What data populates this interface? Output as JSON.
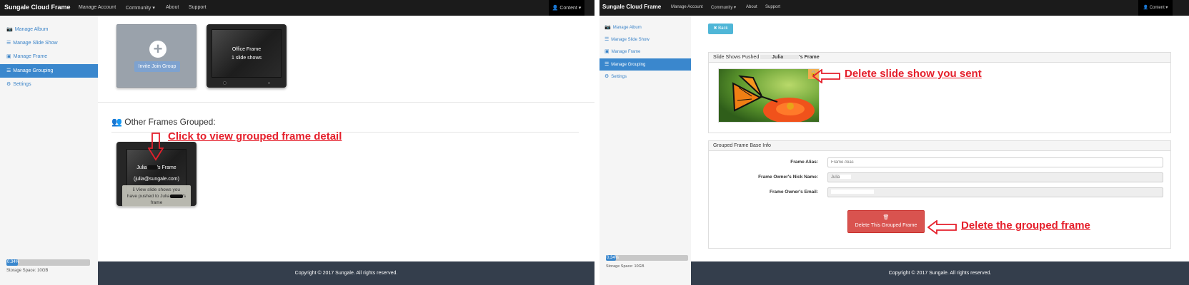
{
  "left": {
    "navbar": {
      "brand": "Sungale Cloud Frame",
      "items": [
        "Manage Account",
        "Community ▾",
        "About",
        "Support"
      ],
      "user_menu": "👤 Content ▾"
    },
    "sidebar": {
      "items": [
        {
          "icon": "camera-icon",
          "glyph": "📷",
          "label": "Manage Album"
        },
        {
          "icon": "list-icon",
          "glyph": "☰",
          "label": "Manage Slide Show"
        },
        {
          "icon": "picture-icon",
          "glyph": "▣",
          "label": "Manage Frame"
        },
        {
          "icon": "users-icon",
          "glyph": "☰",
          "label": "Manage Grouping"
        },
        {
          "icon": "gear-icon",
          "glyph": "⚙",
          "label": "Settings"
        }
      ],
      "active_index": 3,
      "storage_progress": {
        "label": "0.34%",
        "percent": 0.34
      },
      "storage_text": "Storage Space: 10GB"
    },
    "join_card": {
      "button_label": "Invite Join Group"
    },
    "office_frame": {
      "title": "Office Frame",
      "subtitle": "1 slide shows"
    },
    "other_frames_title": "Other Frames Grouped:",
    "grouped_frame": {
      "name_prefix": "Julia",
      "name_suffix": "'s Frame",
      "email": "(julia@sungale.com)",
      "overlay_line1": "ℹ View slide shows you",
      "overlay_line2_prefix": "have pushed to Julia",
      "overlay_line2_suffix": "'s",
      "overlay_line3": "frame"
    },
    "callout": "Click to view grouped frame detail",
    "footer": "Copyright © 2017 Sungale. All rights reserved."
  },
  "right": {
    "navbar": {
      "brand": "Sungale Cloud Frame",
      "items": [
        "Manage Account",
        "Community ▾",
        "About",
        "Support"
      ],
      "user_menu": "👤 Content ▾"
    },
    "sidebar": {
      "items": [
        {
          "icon": "camera-icon",
          "glyph": "📷",
          "label": "Manage Album"
        },
        {
          "icon": "list-icon",
          "glyph": "☰",
          "label": "Manage Slide Show"
        },
        {
          "icon": "picture-icon",
          "glyph": "▣",
          "label": "Manage Frame"
        },
        {
          "icon": "users-icon",
          "glyph": "☰",
          "label": "Manage Grouping"
        },
        {
          "icon": "gear-icon",
          "glyph": "⚙",
          "label": "Settings"
        }
      ],
      "active_index": 3,
      "storage_progress": {
        "label": "0.34%",
        "percent": 0.34
      },
      "storage_text": "Storage Space: 10GB"
    },
    "back_button": "✖ Back",
    "slide_shows_header": {
      "prefix": "Slide Shows Pushed ",
      "name": "Julia",
      "suffix": "'s Frame"
    },
    "delete_slide_callout": "Delete slide show you sent",
    "base_info_header": "Grouped Frame Base Info",
    "form": {
      "alias_label": "Frame Alias:",
      "alias_placeholder": "Frame Alias",
      "nick_label": "Frame Owner's Nick Name:",
      "nick_value": "Julia",
      "email_label": "Frame Owner's Email:"
    },
    "delete_button": {
      "icon": "🗑",
      "label": "Delete This Grouped Frame"
    },
    "delete_frame_callout": "Delete the grouped frame",
    "footer": "Copyright © 2017 Sungale. All rights reserved."
  }
}
